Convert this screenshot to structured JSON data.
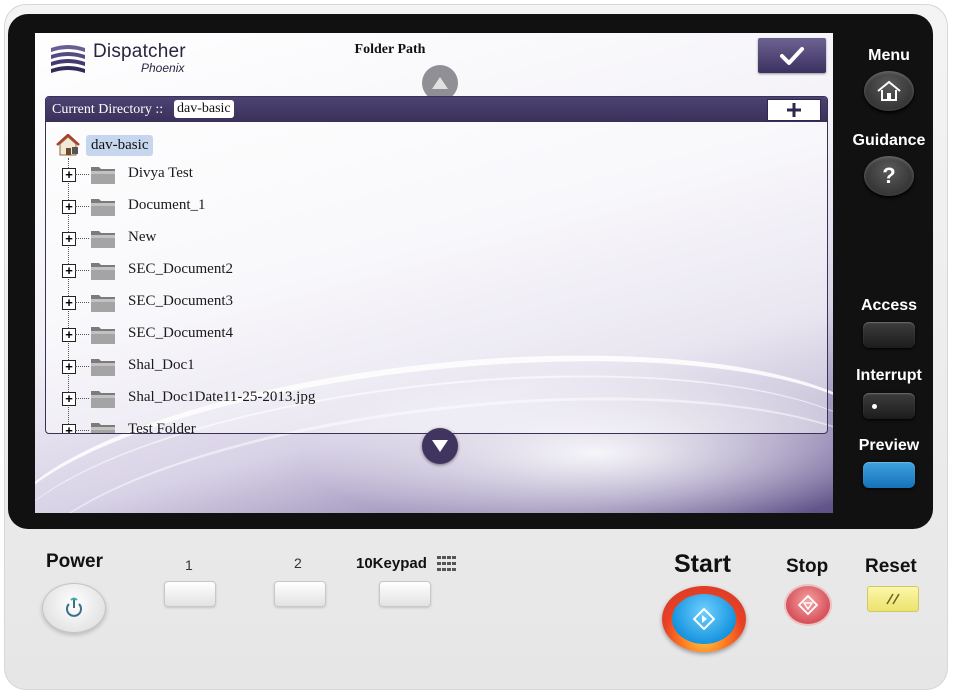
{
  "header": {
    "logo_title": "Dispatcher",
    "logo_subtitle": "Phoenix",
    "title": "Folder Path"
  },
  "directory": {
    "label": "Current Directory ::",
    "current": "dav-basic",
    "root": "dav-basic",
    "folders": [
      {
        "label": "Divya Test"
      },
      {
        "label": "Document_1"
      },
      {
        "label": "New"
      },
      {
        "label": "SEC_Document2"
      },
      {
        "label": "SEC_Document3"
      },
      {
        "label": "SEC_Document4"
      },
      {
        "label": "Shal_Doc1"
      },
      {
        "label": "Shal_Doc1Date11-25-2013.jpg"
      },
      {
        "label": "Test Folder"
      }
    ]
  },
  "side_panel": {
    "menu": "Menu",
    "guidance": "Guidance",
    "guidance_glyph": "?",
    "access": "Access",
    "interrupt": "Interrupt",
    "preview": "Preview"
  },
  "control_panel": {
    "power": "Power",
    "key1": "1",
    "key2": "2",
    "keypad": "10Keypad",
    "start": "Start",
    "stop": "Stop",
    "reset": "Reset"
  },
  "icons": {
    "ok": "checkmark-icon",
    "add": "plus-icon",
    "home": "home-icon",
    "folder": "folder-icon",
    "expand": "plus-box-icon"
  },
  "colors": {
    "accent": "#3b3160",
    "header_bar": "#4d4373",
    "root_highlight": "#c6d6ee",
    "preview_led": "#1e88d0",
    "reset_key": "#f2eb86"
  }
}
